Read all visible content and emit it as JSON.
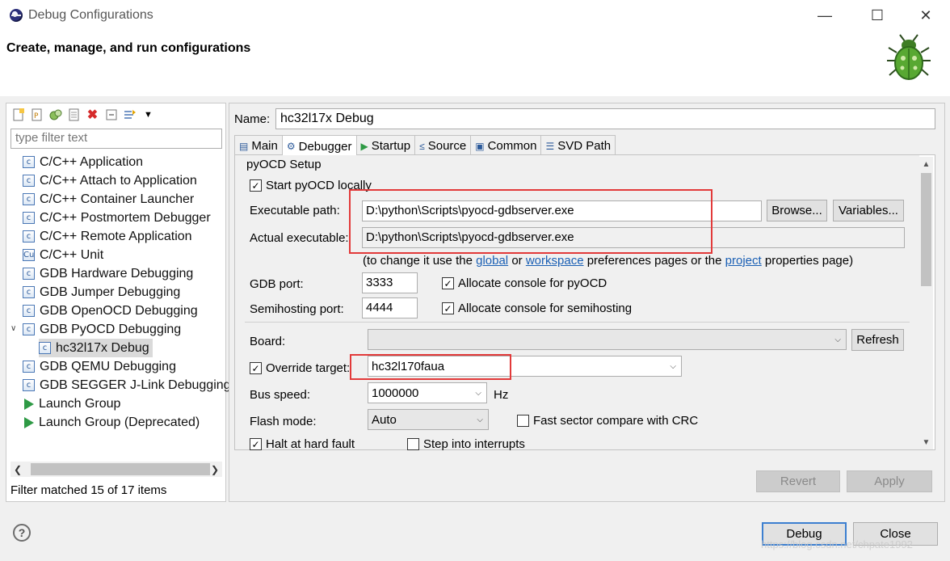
{
  "window": {
    "title": "Debug Configurations",
    "minimize_icon": "minimize-icon",
    "maximize_icon": "maximize-icon",
    "close_icon": "close-icon"
  },
  "header": {
    "title": "Create, manage, and run configurations",
    "banner_icon": "debug-bug-icon"
  },
  "left": {
    "toolbar_icons": [
      "new-config-icon",
      "new-prototype-icon",
      "duplicate-icon",
      "export-icon",
      "delete-icon",
      "collapse-all-icon",
      "filter-icon",
      "view-menu-icon"
    ],
    "filter_placeholder": "type filter text",
    "tree": [
      {
        "label": "C/C++ Application",
        "icon": "c-config-icon"
      },
      {
        "label": "C/C++ Attach to Application",
        "icon": "c-config-icon"
      },
      {
        "label": "C/C++ Container Launcher",
        "icon": "c-config-icon"
      },
      {
        "label": "C/C++ Postmortem Debugger",
        "icon": "c-config-icon"
      },
      {
        "label": "C/C++ Remote Application",
        "icon": "c-config-icon"
      },
      {
        "label": "C/C++ Unit",
        "icon": "c-unit-icon"
      },
      {
        "label": "GDB Hardware Debugging",
        "icon": "c-config-icon"
      },
      {
        "label": "GDB Jumper Debugging",
        "icon": "c-config-icon"
      },
      {
        "label": "GDB OpenOCD Debugging",
        "icon": "c-config-icon"
      },
      {
        "label": "GDB PyOCD Debugging",
        "icon": "c-config-icon",
        "expanded": true
      },
      {
        "label": "hc32l17x Debug",
        "icon": "c-config-icon",
        "child": true,
        "selected": true
      },
      {
        "label": "GDB QEMU Debugging",
        "icon": "c-config-icon"
      },
      {
        "label": "GDB SEGGER J-Link Debugging",
        "icon": "c-config-icon"
      },
      {
        "label": "Launch Group",
        "icon": "launch-group-icon"
      },
      {
        "label": "Launch Group (Deprecated)",
        "icon": "launch-group-icon"
      }
    ],
    "filter_status": "Filter matched 15 of 17 items"
  },
  "right": {
    "name_label": "Name:",
    "name_value": "hc32l17x Debug",
    "tabs": [
      {
        "label": "Main",
        "icon": "main-tab-icon"
      },
      {
        "label": "Debugger",
        "icon": "debugger-tab-icon",
        "active": true
      },
      {
        "label": "Startup",
        "icon": "startup-tab-icon"
      },
      {
        "label": "Source",
        "icon": "source-tab-icon"
      },
      {
        "label": "Common",
        "icon": "common-tab-icon"
      },
      {
        "label": "SVD Path",
        "icon": "svd-tab-icon"
      }
    ],
    "debugger": {
      "group_title": "pyOCD Setup",
      "start_locally": {
        "label": "Start pyOCD locally",
        "checked": true
      },
      "exec_label": "Executable path:",
      "exec_value": "D:\\python\\Scripts\\pyocd-gdbserver.exe",
      "browse": "Browse...",
      "variables": "Variables...",
      "actual_label": "Actual executable:",
      "actual_value": "D:\\python\\Scripts\\pyocd-gdbserver.exe",
      "hint_pre": "(to change it use the",
      "hint_global": "global",
      "hint_or": "or",
      "hint_workspace": "workspace",
      "hint_mid": "preferences pages or the",
      "hint_project": "project",
      "hint_post": "properties page)",
      "gdb_port_label": "GDB port:",
      "gdb_port_value": "3333",
      "alloc_console": {
        "label": "Allocate console for pyOCD",
        "checked": true
      },
      "semi_port_label": "Semihosting port:",
      "semi_port_value": "4444",
      "alloc_semi": {
        "label": "Allocate console for semihosting",
        "checked": true
      },
      "board_label": "Board:",
      "board_value": "",
      "refresh": "Refresh",
      "override_target": {
        "label": "Override target:",
        "checked": true
      },
      "target_value": "hc32l170faua",
      "bus_speed_label": "Bus speed:",
      "bus_speed_value": "1000000",
      "hz": "Hz",
      "flash_mode_label": "Flash mode:",
      "flash_mode_value": "Auto",
      "fast_sector": {
        "label": "Fast sector compare with CRC",
        "checked": false
      },
      "halt_fault": {
        "label": "Halt at hard fault",
        "checked": true
      },
      "step_interrupts": {
        "label": "Step into interrupts",
        "checked": false
      }
    },
    "revert": "Revert",
    "apply": "Apply"
  },
  "footer": {
    "help_icon": "help-icon",
    "help_glyph": "?",
    "debug": "Debug",
    "close": "Close",
    "watermark": "https://blog.csdn.net/chpate1992"
  },
  "colors": {
    "annotation_red": "#e23a3a",
    "link_blue": "#1a5fb4",
    "selection_gray": "#dadada"
  }
}
